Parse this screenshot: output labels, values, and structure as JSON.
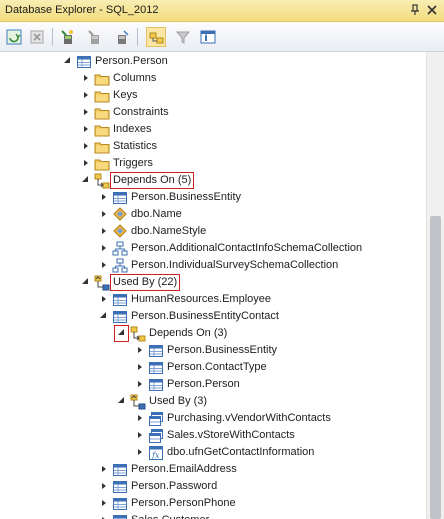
{
  "window": {
    "title": "Database Explorer - SQL_2012"
  },
  "titlebar_buttons": [
    "pin-icon",
    "close-icon"
  ],
  "toolbar": [
    "refresh-icon",
    "stop-icon",
    "connect-icon",
    "disconnect-icon",
    "clear-icon",
    "dependencies-icon",
    "filter-icon",
    "properties-icon"
  ],
  "tree": {
    "rows": [
      {
        "label": "Person.Person",
        "level": 0,
        "state": "expanded",
        "icon": "table-icon"
      },
      {
        "label": "Columns",
        "level": 1,
        "state": "collapsed",
        "icon": "folder-icon"
      },
      {
        "label": "Keys",
        "level": 1,
        "state": "collapsed",
        "icon": "folder-icon"
      },
      {
        "label": "Constraints",
        "level": 1,
        "state": "collapsed",
        "icon": "folder-icon"
      },
      {
        "label": "Indexes",
        "level": 1,
        "state": "collapsed",
        "icon": "folder-icon"
      },
      {
        "label": "Statistics",
        "level": 1,
        "state": "collapsed",
        "icon": "folder-icon"
      },
      {
        "label": "Triggers",
        "level": 1,
        "state": "collapsed",
        "icon": "folder-icon"
      },
      {
        "label": "Depends On (5)",
        "level": 1,
        "state": "expanded",
        "icon": "depends-icon",
        "highlight": true
      },
      {
        "label": "Person.BusinessEntity",
        "level": 2,
        "state": "collapsed",
        "icon": "table-icon"
      },
      {
        "label": "dbo.Name",
        "level": 2,
        "state": "collapsed",
        "icon": "type-icon"
      },
      {
        "label": "dbo.NameStyle",
        "level": 2,
        "state": "collapsed",
        "icon": "type-icon"
      },
      {
        "label": "Person.AdditionalContactInfoSchemaCollection",
        "level": 2,
        "state": "collapsed",
        "icon": "schema-icon"
      },
      {
        "label": "Person.IndividualSurveySchemaCollection",
        "level": 2,
        "state": "collapsed",
        "icon": "schema-icon"
      },
      {
        "label": "Used By (22)",
        "level": 1,
        "state": "expanded",
        "icon": "usedby-icon",
        "highlight": true
      },
      {
        "label": "HumanResources.Employee",
        "level": 2,
        "state": "collapsed",
        "icon": "table-icon"
      },
      {
        "label": "Person.BusinessEntityContact",
        "level": 2,
        "state": "expanded",
        "icon": "table-icon"
      },
      {
        "label": "Depends On (3)",
        "level": 3,
        "state": "expanded",
        "icon": "depends-icon",
        "expander_highlight": true
      },
      {
        "label": "Person.BusinessEntity",
        "level": 4,
        "state": "collapsed",
        "icon": "table-icon"
      },
      {
        "label": "Person.ContactType",
        "level": 4,
        "state": "collapsed",
        "icon": "table-icon"
      },
      {
        "label": "Person.Person",
        "level": 4,
        "state": "collapsed",
        "icon": "table-icon"
      },
      {
        "label": "Used By (3)",
        "level": 3,
        "state": "expanded",
        "icon": "usedby-icon"
      },
      {
        "label": "Purchasing.vVendorWithContacts",
        "level": 4,
        "state": "collapsed",
        "icon": "view-icon"
      },
      {
        "label": "Sales.vStoreWithContacts",
        "level": 4,
        "state": "collapsed",
        "icon": "view-icon"
      },
      {
        "label": "dbo.ufnGetContactInformation",
        "level": 4,
        "state": "collapsed",
        "icon": "function-icon"
      },
      {
        "label": "Person.EmailAddress",
        "level": 2,
        "state": "collapsed",
        "icon": "table-icon"
      },
      {
        "label": "Person.Password",
        "level": 2,
        "state": "collapsed",
        "icon": "table-icon"
      },
      {
        "label": "Person.PersonPhone",
        "level": 2,
        "state": "collapsed",
        "icon": "table-icon"
      },
      {
        "label": "Sales.Customer",
        "level": 2,
        "state": "collapsed",
        "icon": "table-icon"
      }
    ]
  },
  "colors": {
    "title_bg": "#f2dc7e",
    "highlight": "#d02020",
    "table_blue": "#3b6fb6",
    "folder": "#e8b84a"
  }
}
